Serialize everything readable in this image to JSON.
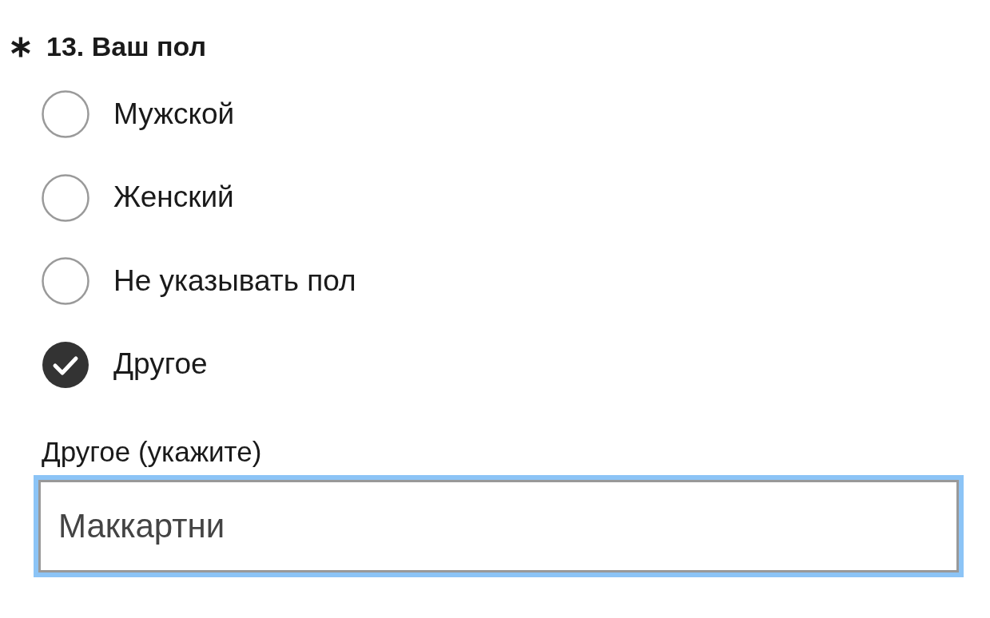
{
  "question": {
    "required_mark": "∗",
    "title": "13. Ваш пол"
  },
  "options": [
    {
      "label": "Мужской",
      "selected": false
    },
    {
      "label": "Женский",
      "selected": false
    },
    {
      "label": "Не указывать пол",
      "selected": false
    },
    {
      "label": "Другое",
      "selected": true
    }
  ],
  "other": {
    "label": "Другое (укажите)",
    "value": "Маккартни",
    "focused": true
  }
}
